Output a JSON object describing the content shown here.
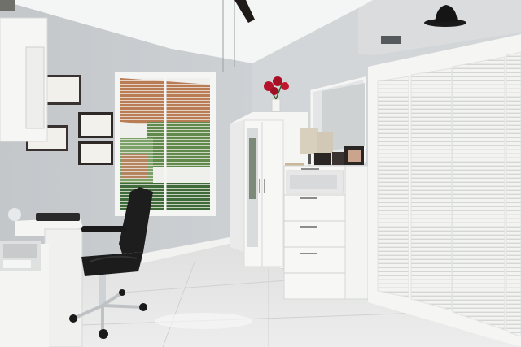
{
  "scene": {
    "room": "home-office",
    "colors": {
      "wall": "#c7cbce",
      "wall_light": "#d6d9dc",
      "ceiling": "#f3f4f4",
      "floor": "#e2e3e2",
      "white_furniture": "#f4f4f3",
      "chair": "#1c1c1c",
      "roses": "#b3122a",
      "window_green": "#5d8a4a",
      "lamp_shade": "#d9cfbd"
    },
    "objects": [
      "ceiling-fan",
      "wall-shelf",
      "framed-certificate",
      "window-with-blinds",
      "office-chair",
      "desk",
      "printer",
      "wardrobe",
      "mirror",
      "dresser",
      "table-lamp",
      "picture-frames",
      "rose-vase",
      "closet-louvered-doors",
      "hat",
      "tile-floor"
    ]
  }
}
